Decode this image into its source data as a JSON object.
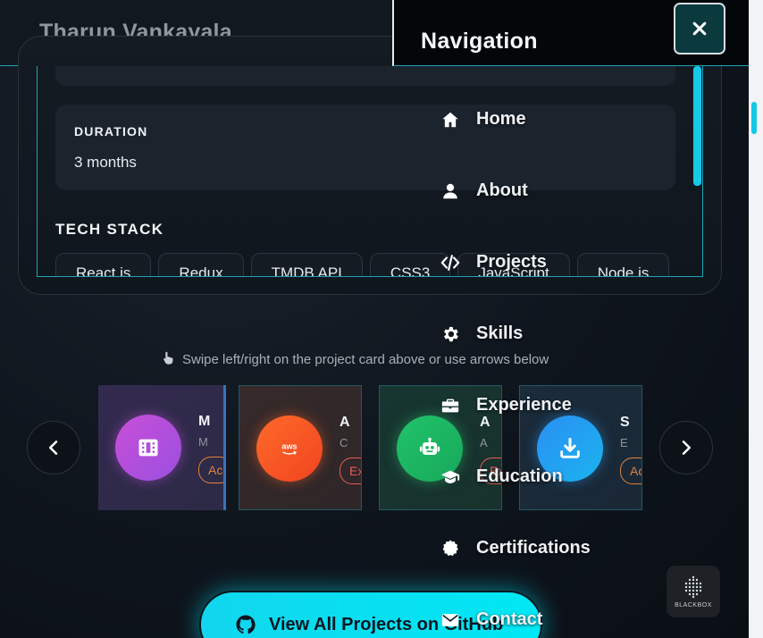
{
  "header": {
    "brand": "Tharun Vankayala"
  },
  "project": {
    "duration_label": "DURATION",
    "duration_value": "3 months",
    "tech_stack_title": "TECH STACK",
    "tech_stack": [
      "React.js",
      "Redux",
      "TMDB API",
      "CSS3",
      "JavaScript",
      "Node.js"
    ]
  },
  "hint": {
    "text": "Swipe left/right on the project card above or use arrows below",
    "icon": "pointer-hand-icon"
  },
  "carousel": {
    "cards": [
      {
        "icon": "film-icon",
        "title": "M",
        "subtitle": "M",
        "badge": "Ac",
        "gradient": [
          "#c94fd8",
          "#9b4fe0"
        ],
        "badge_color": "#e0823c"
      },
      {
        "icon": "aws-icon",
        "icon_text": "aws",
        "title": "A",
        "subtitle": "C",
        "badge": "Ex",
        "gradient": [
          "#ff6a2a",
          "#f0441f"
        ],
        "badge_color": "#e85a5a"
      },
      {
        "icon": "robot-icon",
        "title": "A",
        "subtitle": "A",
        "badge": "Ex",
        "gradient": [
          "#22c36a",
          "#17a85a"
        ],
        "badge_color": "#e85a5a"
      },
      {
        "icon": "download-icon",
        "title": "S",
        "subtitle": "E",
        "badge": "Ac",
        "gradient": [
          "#2b8ff2",
          "#1bb3f0"
        ],
        "badge_color": "#e0823c"
      }
    ]
  },
  "cta": {
    "label": "View All Projects on GitHub",
    "icon": "github-icon"
  },
  "nav": {
    "title": "Navigation",
    "close_icon": "close-icon",
    "items": [
      {
        "label": "Home",
        "icon": "home-icon"
      },
      {
        "label": "About",
        "icon": "user-icon"
      },
      {
        "label": "Projects",
        "icon": "code-icon"
      },
      {
        "label": "Skills",
        "icon": "gear-icon"
      },
      {
        "label": "Experience",
        "icon": "briefcase-icon"
      },
      {
        "label": "Education",
        "icon": "graduation-cap-icon"
      },
      {
        "label": "Certifications",
        "icon": "certificate-icon"
      },
      {
        "label": "Contact",
        "icon": "envelope-icon"
      }
    ]
  },
  "blackbox": {
    "label": "BLACKBOX"
  },
  "colors": {
    "accent": "#12d6ee",
    "panel": "#1b232d",
    "background": "#0c121a"
  }
}
